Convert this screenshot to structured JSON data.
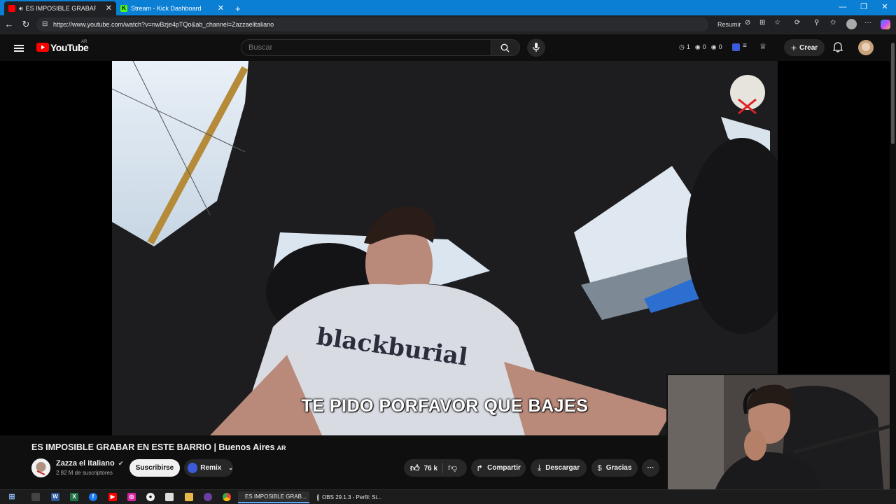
{
  "browser": {
    "tabs": [
      {
        "title": "ES IMPOSIBLE GRABAR EN E",
        "favicon": "youtube-favicon",
        "active": true
      },
      {
        "title": "Stream - Kick Dashboard",
        "favicon": "kick-favicon",
        "active": false
      }
    ],
    "new_tab": "+",
    "window_controls": {
      "minimize": "—",
      "restore": "❐",
      "close": "✕"
    },
    "url": "https://www.youtube.com/watch?v=nwBzje4pTQo&ab_channel=Zazzaelitaliano",
    "resumir_label": "Resumir"
  },
  "youtube": {
    "logo_text": "YouTube",
    "logo_region": "AR",
    "search_placeholder": "Buscar",
    "header_stats": [
      "1",
      "0",
      "0"
    ],
    "crear_label": "Crear"
  },
  "video": {
    "subtitle": "TE PIDO PORFAVOR QUE BAJES",
    "title": "ES IMPOSIBLE GRABAR EN ESTE BARRIO | Buenos Aires",
    "title_badge": "AR",
    "channel_name": "Zazza el italiano",
    "subscribers": "2.82 M de suscriptores",
    "subscribe_label": "Suscribirse",
    "remix_label": "Remix",
    "likes": "76 k",
    "share_label": "Compartir",
    "download_label": "Descargar",
    "thanks_label": "Gracias",
    "more_label": "···"
  },
  "taskbar": {
    "tasks": [
      {
        "title": "ES IMPOSIBLE GRAB...",
        "active": true
      },
      {
        "title": "OBS 29.1.3 - Perfil: Si...",
        "active": false
      }
    ]
  },
  "colors": {
    "browser_accent": "#0a7fd4",
    "youtube_red": "#ff0000",
    "background": "#0f0f0f",
    "kick_green": "#53fc18"
  }
}
